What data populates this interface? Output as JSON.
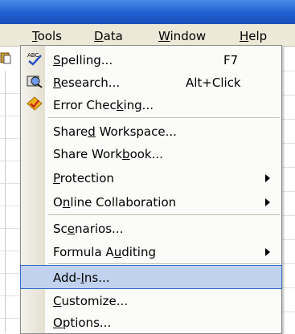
{
  "menubar": {
    "items": [
      {
        "prefix": "",
        "mnemonic": "T",
        "suffix": "ools"
      },
      {
        "prefix": "",
        "mnemonic": "D",
        "suffix": "ata"
      },
      {
        "prefix": "",
        "mnemonic": "W",
        "suffix": "indow"
      },
      {
        "prefix": "",
        "mnemonic": "H",
        "suffix": "elp"
      }
    ]
  },
  "dropdown": {
    "items": [
      {
        "icon": "spelling-icon",
        "prefix": "",
        "mnemonic": "S",
        "suffix": "pelling...",
        "shortcut": "F7",
        "submenu": false
      },
      {
        "icon": "research-icon",
        "prefix": "",
        "mnemonic": "R",
        "suffix": "esearch...",
        "shortcut": "Alt+Click",
        "submenu": false
      },
      {
        "icon": "error-checking-icon",
        "prefix": "Error Chec",
        "mnemonic": "k",
        "suffix": "ing...",
        "shortcut": "",
        "submenu": false
      },
      {
        "icon": "",
        "prefix": "Share",
        "mnemonic": "d",
        "suffix": " Workspace...",
        "shortcut": "",
        "submenu": false
      },
      {
        "icon": "",
        "prefix": "Share Work",
        "mnemonic": "b",
        "suffix": "ook...",
        "shortcut": "",
        "submenu": false
      },
      {
        "icon": "",
        "prefix": "",
        "mnemonic": "P",
        "suffix": "rotection",
        "shortcut": "",
        "submenu": true
      },
      {
        "icon": "",
        "prefix": "O",
        "mnemonic": "n",
        "suffix": "line Collaboration",
        "shortcut": "",
        "submenu": true
      },
      {
        "icon": "",
        "prefix": "Sc",
        "mnemonic": "e",
        "suffix": "narios...",
        "shortcut": "",
        "submenu": false
      },
      {
        "icon": "",
        "prefix": "Formula A",
        "mnemonic": "u",
        "suffix": "diting",
        "shortcut": "",
        "submenu": true
      },
      {
        "icon": "",
        "prefix": "Add-",
        "mnemonic": "I",
        "suffix": "ns...",
        "shortcut": "",
        "submenu": false
      },
      {
        "icon": "",
        "prefix": "",
        "mnemonic": "C",
        "suffix": "ustomize...",
        "shortcut": "",
        "submenu": false
      },
      {
        "icon": "",
        "prefix": "",
        "mnemonic": "O",
        "suffix": "ptions...",
        "shortcut": "",
        "submenu": false
      }
    ],
    "highlighted": "Add-Ins..."
  },
  "colors": {
    "titlebar": "#1f5fd1",
    "menubar": "#ece9d8",
    "highlight": "#c1d2ee",
    "highlight_border": "#316ac5"
  }
}
